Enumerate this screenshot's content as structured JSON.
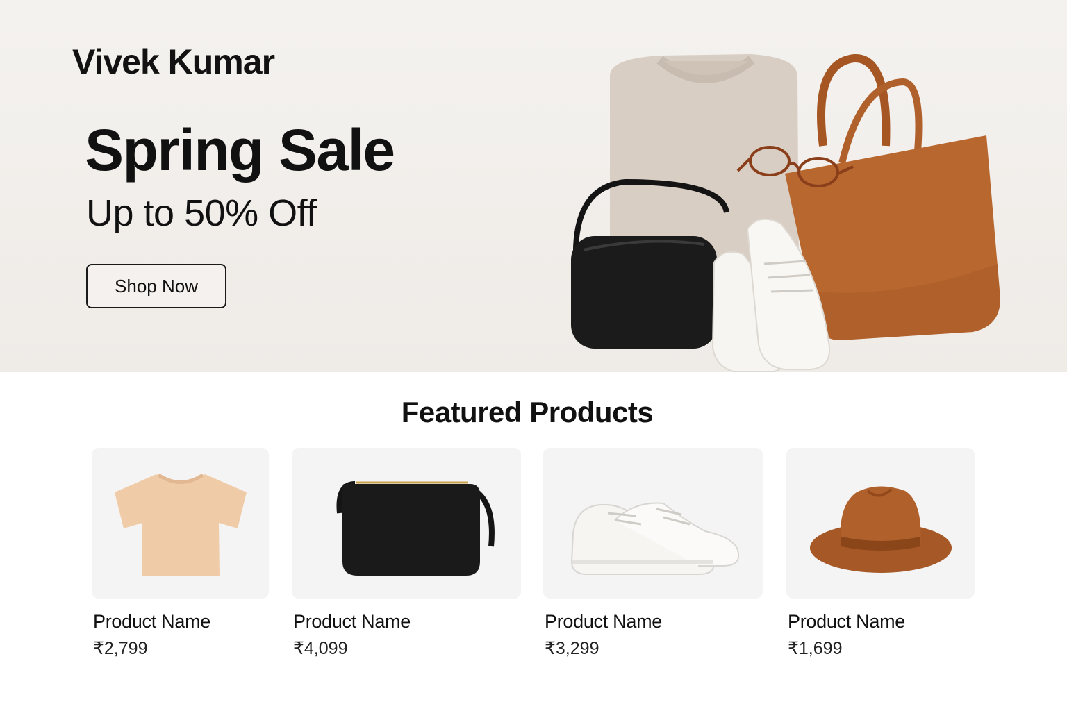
{
  "brand": {
    "name": "Vivek Kumar"
  },
  "hero": {
    "title": "Spring Sale",
    "subtitle": "Up to 50% Off",
    "cta_label": "Shop Now"
  },
  "featured": {
    "title": "Featured Products",
    "products": [
      {
        "name": "Product Name",
        "price": "₹2,799",
        "image": "tshirt-image"
      },
      {
        "name": "Product Name",
        "price": "₹4,099",
        "image": "black-handbag-image"
      },
      {
        "name": "Product Name",
        "price": "₹3,299",
        "image": "white-sneakers-image"
      },
      {
        "name": "Product Name",
        "price": "₹1,699",
        "image": "brown-hat-image"
      }
    ]
  },
  "colors": {
    "hero_bg": "#f2efec",
    "accent_tan": "#b9682f",
    "text": "#111111",
    "card_bg": "#f4f4f4"
  }
}
